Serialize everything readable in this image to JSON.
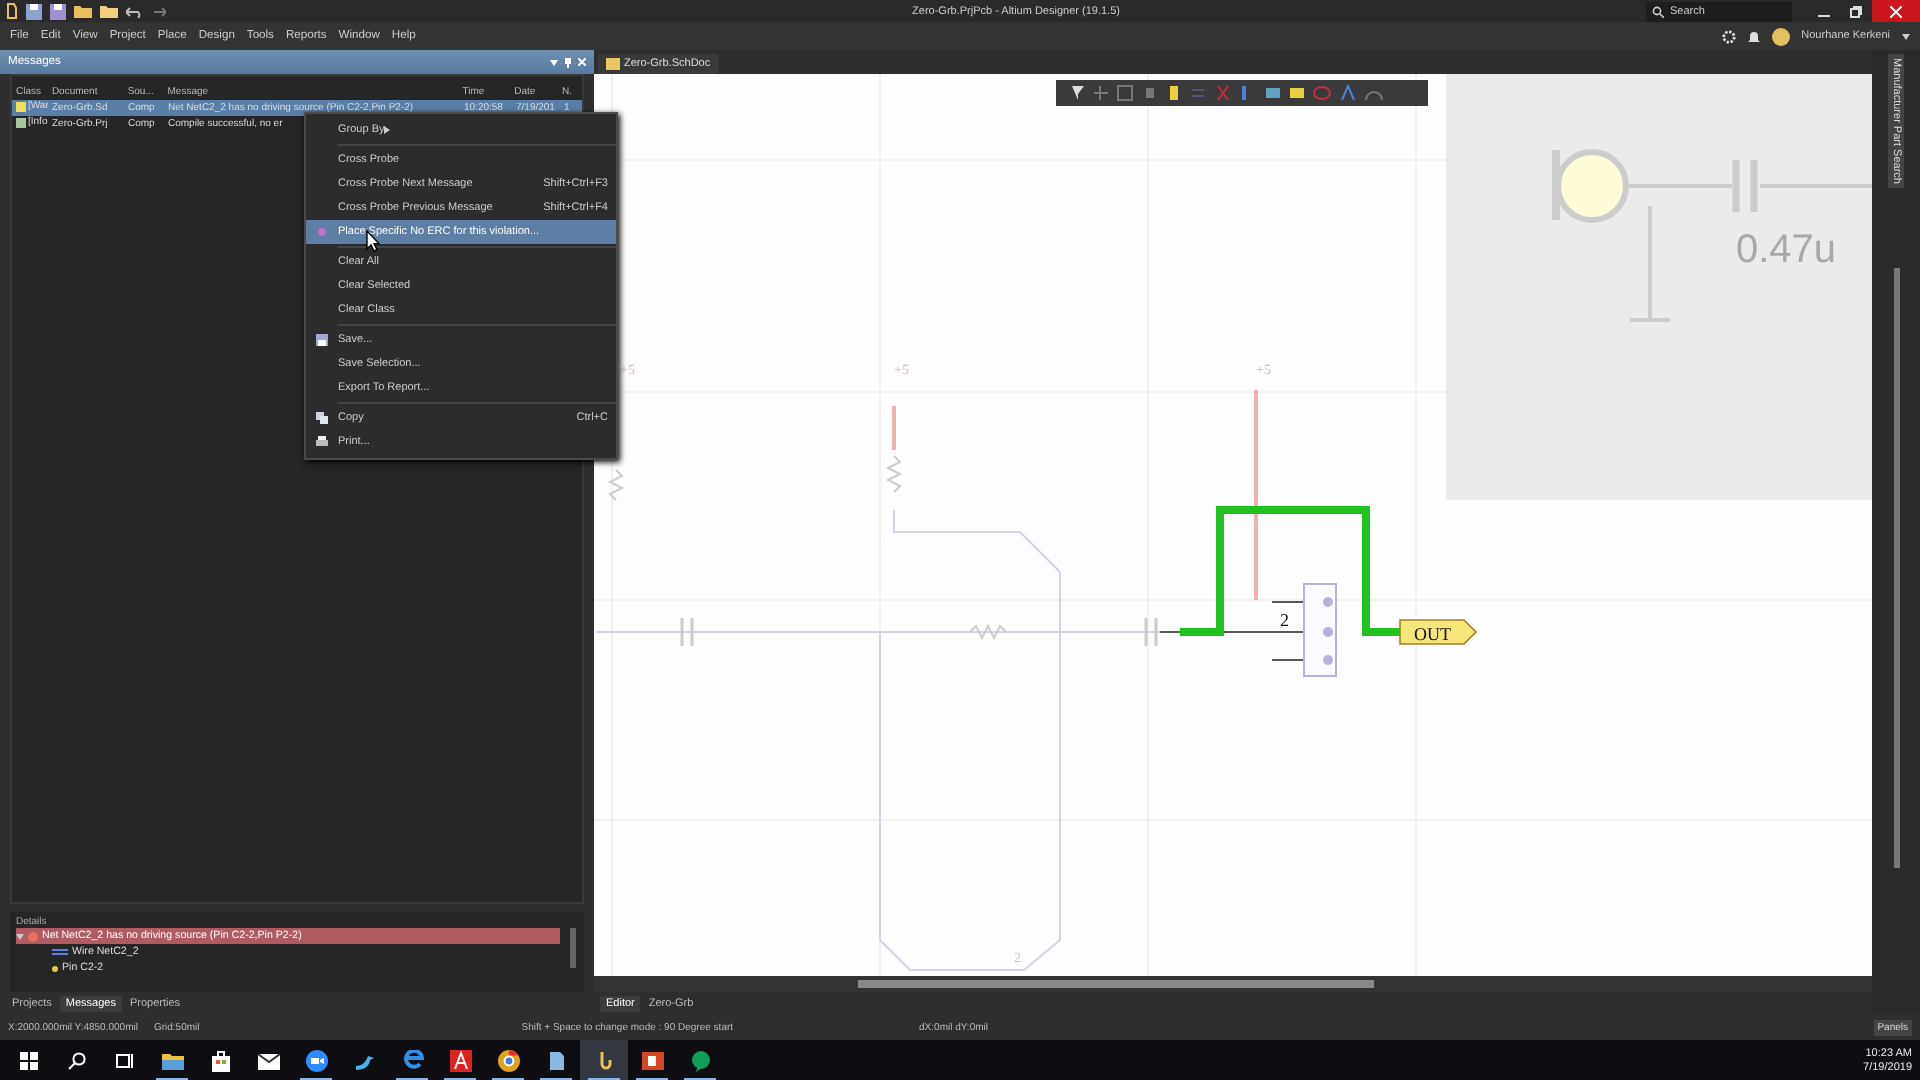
{
  "window": {
    "title": "Zero-Grb.PrjPcb - Altium Designer (19.1.5)",
    "search": {
      "placeholder": "Search"
    }
  },
  "menu": [
    "File",
    "Edit",
    "View",
    "Project",
    "Place",
    "Design",
    "Tools",
    "Reports",
    "Window",
    "Help"
  ],
  "user": {
    "name": "Nourhane Kerkeni"
  },
  "messages_panel": {
    "title": "Messages",
    "columns": [
      "Class",
      "Document",
      "Sou...",
      "Message",
      "Time",
      "Date",
      "N."
    ],
    "rows": [
      {
        "kind": "warning",
        "selected": true,
        "cells": [
          "[War",
          "Zero-Grb.Sd",
          "Comp",
          "Net NetC2_2 has no driving source (Pin C2-2,Pin P2-2)",
          "10:20:58",
          "7/19/201",
          "1"
        ]
      },
      {
        "kind": "info",
        "selected": false,
        "cells": [
          "[Info",
          "Zero-Grb.Prj",
          "Comp",
          "Compile successful, no er"
        ]
      }
    ]
  },
  "context_menu": {
    "groups": [
      [
        {
          "label": "Group By",
          "kind": "submenu",
          "selected": false
        }
      ],
      [
        {
          "label": "Cross Probe",
          "kind": "plain",
          "selected": false
        },
        {
          "label": "Cross Probe Next Message",
          "kind": "plain",
          "shortcut": "Shift+Ctrl+F3",
          "selected": false
        },
        {
          "label": "Cross Probe Previous Message",
          "kind": "plain",
          "shortcut": "Shift+Ctrl+F4",
          "selected": false
        },
        {
          "label": "Place Specific No ERC for this violation...",
          "kind": "dot",
          "selected": true
        }
      ],
      [
        {
          "label": "Clear All",
          "kind": "plain",
          "selected": false
        },
        {
          "label": "Clear Selected",
          "kind": "plain",
          "selected": false
        },
        {
          "label": "Clear Class",
          "kind": "plain",
          "selected": false
        }
      ],
      [
        {
          "label": "Save...",
          "kind": "disk",
          "selected": false
        },
        {
          "label": "Save Selection...",
          "kind": "plain",
          "selected": false
        },
        {
          "label": "Export To Report...",
          "kind": "plain",
          "selected": false
        }
      ],
      [
        {
          "label": "Copy",
          "kind": "copy",
          "shortcut": "Ctrl+C",
          "selected": false
        },
        {
          "label": "Print...",
          "kind": "print",
          "selected": false
        }
      ]
    ]
  },
  "details": {
    "title": "Details",
    "items": [
      {
        "text": "Net NetC2_2 has no driving source (Pin C2-2,Pin P2-2)",
        "kind": "error",
        "expanded": true,
        "children": [
          {
            "text": "Wire NetC2_2",
            "kind": "wire"
          },
          {
            "text": "Pin C2-2",
            "kind": "pin"
          }
        ]
      }
    ]
  },
  "panel_tabs": [
    {
      "label": "Projects",
      "selected": false
    },
    {
      "label": "Messages",
      "selected": true
    },
    {
      "label": "Properties",
      "selected": false
    }
  ],
  "document_tab": {
    "label": "Zero-Grb.SchDoc"
  },
  "side_panel": {
    "label": "Manufacturer Part Search"
  },
  "schematic": {
    "value_label": "0.47u",
    "port": "OUT",
    "labels": [
      {
        "text": "+5",
        "kind": "faint"
      },
      {
        "text": "+5",
        "kind": "faint"
      },
      {
        "text": "+5",
        "kind": "faint"
      },
      {
        "text": "2",
        "kind": "dark"
      },
      {
        "text": "2",
        "kind": "faint"
      }
    ]
  },
  "editor_tabs": [
    {
      "label": "Editor",
      "selected": true
    },
    {
      "label": "Zero-Grb",
      "selected": false
    }
  ],
  "status_bar": {
    "coordinates": "X:2000.000mil Y:4850.000mil",
    "grid": "Grid:50mil",
    "hint": "Shift + Space to change mode : 90 Degree start",
    "delta": "dX:0mil dY:0mil",
    "panels_button": "Panels"
  },
  "taskbar": {
    "apps": [
      {
        "kind": "folder",
        "running": true,
        "selected": false
      },
      {
        "kind": "bag",
        "running": false,
        "selected": false
      },
      {
        "kind": "mail",
        "running": false,
        "selected": false
      },
      {
        "kind": "camera",
        "running": true,
        "selected": false
      },
      {
        "kind": "bird",
        "running": false,
        "selected": false
      },
      {
        "kind": "e",
        "running": true,
        "selected": false
      },
      {
        "kind": "a",
        "running": true,
        "selected": false
      },
      {
        "kind": "chrome",
        "running": true,
        "selected": false
      },
      {
        "kind": "doc",
        "running": true,
        "selected": false
      },
      {
        "kind": "hook",
        "running": true,
        "selected": true
      },
      {
        "kind": "slides",
        "running": true,
        "selected": false
      },
      {
        "kind": "chat",
        "running": true,
        "selected": false
      }
    ],
    "time": "10:23 AM",
    "date": "7/19/2019"
  }
}
